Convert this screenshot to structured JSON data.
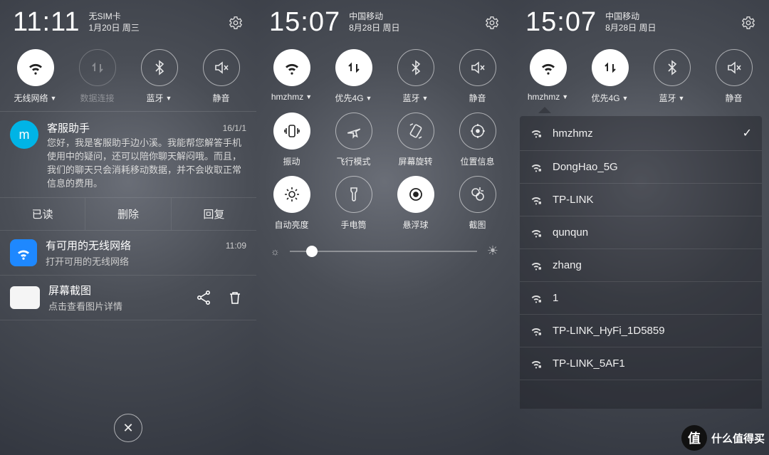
{
  "screen1": {
    "time": "11:11",
    "carrier": "无SIM卡",
    "date": "1月20日 周三",
    "toggles": [
      {
        "id": "wifi",
        "label": "无线网络",
        "caret": true,
        "state": "on"
      },
      {
        "id": "data",
        "label": "数据连接",
        "caret": false,
        "state": "disabled"
      },
      {
        "id": "bt",
        "label": "蓝牙",
        "caret": true,
        "state": "off"
      },
      {
        "id": "mute",
        "label": "静音",
        "caret": false,
        "state": "off"
      }
    ],
    "notif1": {
      "title": "客服助手",
      "time": "16/1/1",
      "body": "您好，我是客服助手边小溪。我能帮您解答手机使用中的疑问，还可以陪你聊天解闷哦。而且，我们的聊天只会消耗移动数据，并不会收取正常信息的费用。",
      "actions": [
        "已读",
        "删除",
        "回复"
      ]
    },
    "notif2": {
      "title": "有可用的无线网络",
      "sub": "打开可用的无线网络",
      "time": "11:09"
    },
    "notif3": {
      "title": "屏幕截图",
      "sub": "点击查看图片详情"
    }
  },
  "screen2": {
    "time": "15:07",
    "carrier": "中国移动",
    "date": "8月28日 周日",
    "toggles": [
      {
        "id": "wifi",
        "label": "hmzhmz",
        "caret": true,
        "state": "on"
      },
      {
        "id": "data",
        "label": "优先4G",
        "caret": true,
        "state": "on"
      },
      {
        "id": "bt",
        "label": "蓝牙",
        "caret": true,
        "state": "off"
      },
      {
        "id": "mute",
        "label": "静音",
        "caret": false,
        "state": "off"
      },
      {
        "id": "vibrate",
        "label": "振动",
        "caret": false,
        "state": "on"
      },
      {
        "id": "airplane",
        "label": "飞行模式",
        "caret": false,
        "state": "off"
      },
      {
        "id": "rotate",
        "label": "屏幕旋转",
        "caret": false,
        "state": "off"
      },
      {
        "id": "location",
        "label": "位置信息",
        "caret": false,
        "state": "off"
      },
      {
        "id": "brightness",
        "label": "自动亮度",
        "caret": false,
        "state": "on"
      },
      {
        "id": "torch",
        "label": "手电筒",
        "caret": false,
        "state": "off"
      },
      {
        "id": "floatball",
        "label": "悬浮球",
        "caret": false,
        "state": "on"
      },
      {
        "id": "screenshot",
        "label": "截图",
        "caret": false,
        "state": "off"
      }
    ]
  },
  "screen3": {
    "time": "15:07",
    "carrier": "中国移动",
    "date": "8月28日 周日",
    "toggles": [
      {
        "id": "wifi",
        "label": "hmzhmz",
        "caret": true,
        "state": "on"
      },
      {
        "id": "data",
        "label": "优先4G",
        "caret": true,
        "state": "on"
      },
      {
        "id": "bt",
        "label": "蓝牙",
        "caret": true,
        "state": "off"
      },
      {
        "id": "mute",
        "label": "静音",
        "caret": false,
        "state": "off"
      }
    ],
    "wifiList": [
      {
        "name": "hmzhmz",
        "lock": true,
        "connected": true
      },
      {
        "name": "DongHao_5G",
        "lock": true,
        "connected": false
      },
      {
        "name": "TP-LINK",
        "lock": true,
        "connected": false
      },
      {
        "name": "qunqun",
        "lock": true,
        "connected": false
      },
      {
        "name": "zhang",
        "lock": true,
        "connected": false
      },
      {
        "name": "1",
        "lock": true,
        "connected": false
      },
      {
        "name": "TP-LINK_HyFi_1D5859",
        "lock": true,
        "connected": false
      },
      {
        "name": "TP-LINK_5AF1",
        "lock": true,
        "connected": false
      }
    ]
  },
  "watermark": "什么值得买"
}
